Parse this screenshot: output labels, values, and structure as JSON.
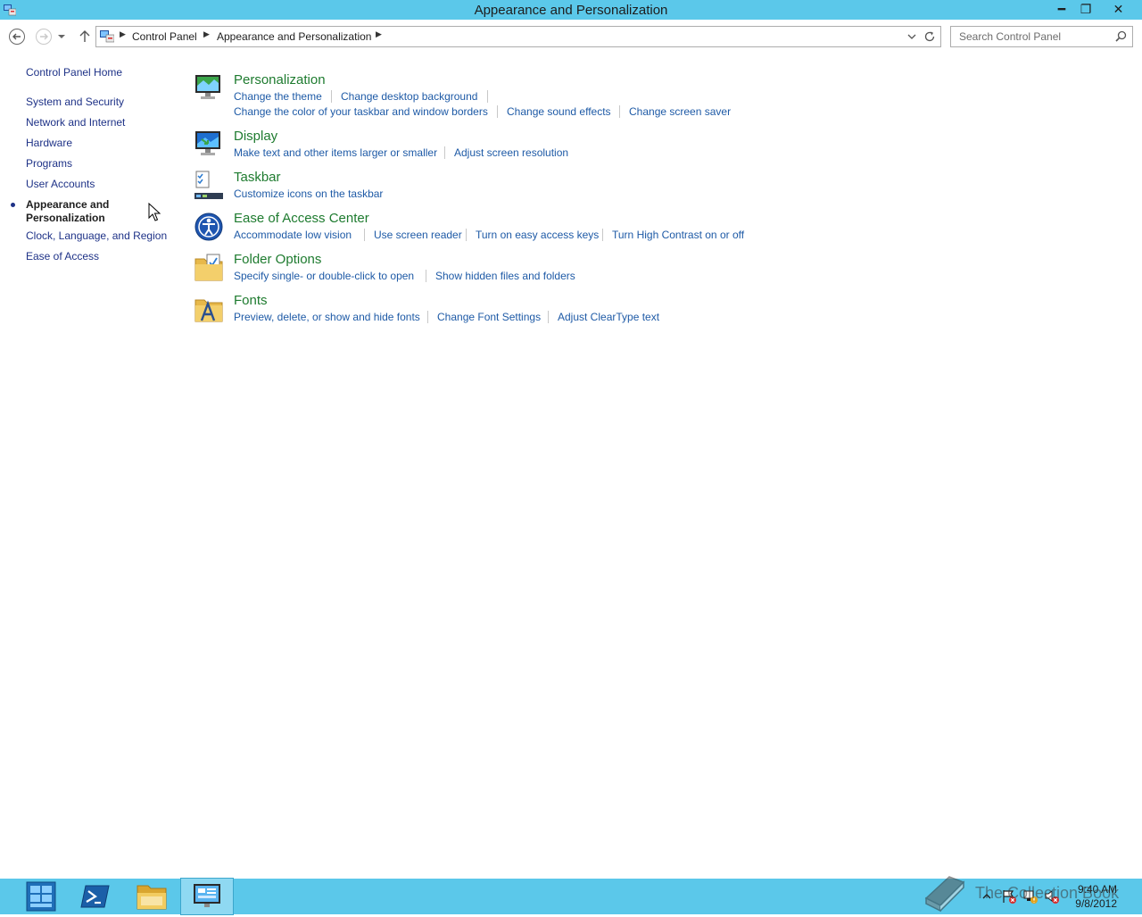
{
  "window": {
    "title": "Appearance and Personalization",
    "minimize_glyph": "━",
    "restore_glyph": "❐",
    "close_glyph": "✕"
  },
  "address": {
    "crumbs": [
      "Control Panel",
      "Appearance and Personalization"
    ],
    "search_placeholder": "Search Control Panel"
  },
  "sidebar": {
    "home": "Control Panel Home",
    "items": [
      {
        "label": "System and Security"
      },
      {
        "label": "Network and Internet"
      },
      {
        "label": "Hardware"
      },
      {
        "label": "Programs"
      },
      {
        "label": "User Accounts"
      },
      {
        "label": "Appearance and Personalization",
        "current": true
      },
      {
        "label": "Clock, Language, and Region"
      },
      {
        "label": "Ease of Access"
      }
    ]
  },
  "categories": [
    {
      "title": "Personalization",
      "icon": "personalization-icon",
      "links": [
        "Change the theme",
        "Change desktop background",
        "Change the color of your taskbar and window borders",
        "Change sound effects",
        "Change screen saver"
      ]
    },
    {
      "title": "Display",
      "icon": "display-icon",
      "links": [
        "Make text and other items larger or smaller",
        "Adjust screen resolution"
      ]
    },
    {
      "title": "Taskbar",
      "icon": "taskbar-icon",
      "links": [
        "Customize icons on the taskbar"
      ]
    },
    {
      "title": "Ease of Access Center",
      "icon": "ease-of-access-icon",
      "links": [
        "Accommodate low vision",
        "Use screen reader",
        "Turn on easy access keys",
        "Turn High Contrast on or off"
      ]
    },
    {
      "title": "Folder Options",
      "icon": "folder-options-icon",
      "links": [
        "Specify single- or double-click to open",
        "Show hidden files and folders"
      ]
    },
    {
      "title": "Fonts",
      "icon": "fonts-icon",
      "links": [
        "Preview, delete, or show and hide fonts",
        "Change Font Settings",
        "Adjust ClearType text"
      ]
    }
  ],
  "taskbar": {
    "clock_time": "9:40 AM",
    "clock_date": "9/8/2012",
    "watermark": "The Collection Book"
  },
  "colors": {
    "titlebar": "#5bc8ea",
    "category_title": "#1e7b2f",
    "link": "#1e5aa6",
    "sidebar_link": "#1e3287"
  }
}
